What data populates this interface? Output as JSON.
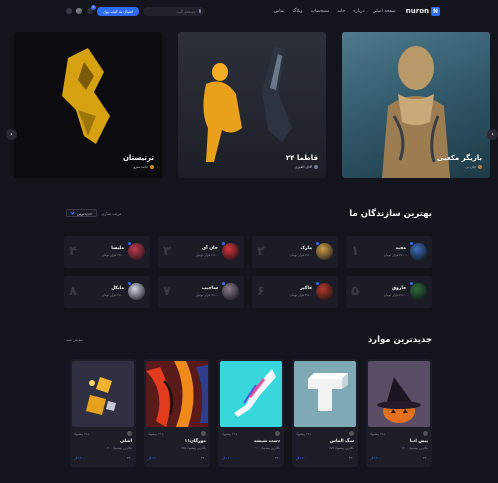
{
  "nav": {
    "logo_letter": "N",
    "logo_text": "nuron",
    "menu": [
      "صفحه اصلی",
      "درباره",
      "خانه",
      "مشخصات",
      "وبلاگ",
      "تماس"
    ],
    "search_placeholder": "جستجو کنید",
    "wallet_label": "اتصال به کیف پول",
    "notification_count": "2"
  },
  "hero": {
    "slides": [
      {
        "title": "بازیگر مکعبی",
        "subtitle": "جان بی"
      },
      {
        "title": "قاطما ۲۴",
        "subtitle": "آقای الفیری"
      },
      {
        "title": "ترتیستان",
        "subtitle": "حامد مترو"
      }
    ]
  },
  "creators": {
    "title": "بهترین سازندگان ما",
    "sort_label": "مرتب سازی",
    "sort_value": "جدیدترین",
    "items": [
      {
        "rank": "۱",
        "name": "مجید",
        "value": "۲۵۰۰ هزار تومان",
        "color": "#3b6fb8"
      },
      {
        "rank": "۲",
        "name": "مارک",
        "value": "۲۵۰۰ هزار تومان",
        "color": "#d0a04a"
      },
      {
        "rank": "۳",
        "name": "جان آی",
        "value": "۲۵۰۰ هزار تومان",
        "color": "#d3343d"
      },
      {
        "rank": "۴",
        "name": "ملیسا",
        "value": "۲۵۰۰ هزار تومان",
        "color": "#c23b4e"
      },
      {
        "rank": "۵",
        "name": "فاروق",
        "value": "۲۵۰۰ هزار تومان",
        "color": "#2f6b3c"
      },
      {
        "rank": "۶",
        "name": "فاکیر",
        "value": "۲۵۰۰ هزار تومان",
        "color": "#b43a2a"
      },
      {
        "rank": "۷",
        "name": "ساجیپ",
        "value": "۲۵۰۰ هزار تومان",
        "color": "#8a7a8a"
      },
      {
        "rank": "۸",
        "name": "مایکل",
        "value": "۲۵۰۰ هزار تومان",
        "color": "#cfd4e0"
      }
    ]
  },
  "newest": {
    "title": "جدیدترین موارد",
    "view_all": "نمایش همه",
    "items": [
      {
        "title": "پیش ادبا",
        "meta": "+۱۲ پیشنهاد",
        "bid": "بالاترین پیشنهاد ۱۳۰۰",
        "price": "۲۰۰ دلار",
        "likes": "۳۲۰"
      },
      {
        "title": "سگ الماس",
        "meta": "+۱۲ پیشنهاد",
        "bid": "بالاترین پیشنهاد ۸۵۷",
        "price": "۲۰۰ دلار",
        "likes": "۳۲۰"
      },
      {
        "title": "دست شیشه",
        "meta": "+۱۲ پیشنهاد",
        "bid": "بالاترین پیشنهاد ۹۰۰",
        "price": "۲۰۰ دلار",
        "likes": "۳۲۰"
      },
      {
        "title": "مورگان۱۱",
        "meta": "+۱۲ پیشنهاد",
        "bid": "بالاترین پیشنهاد ۳۶۵",
        "price": "۲۰۰ دلار",
        "likes": "۳۲۰"
      },
      {
        "title": "اشلی",
        "meta": "+۱۲ پیشنهاد",
        "bid": "بالاترین پیشنهاد ۴۰۰",
        "price": "۲۰۰ دلار",
        "likes": "۳۲۰"
      }
    ]
  },
  "colors": {
    "accent": "#2f6bff",
    "bg": "#14141c",
    "card": "#1d1d27"
  }
}
